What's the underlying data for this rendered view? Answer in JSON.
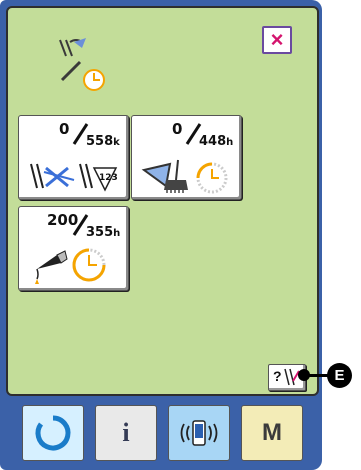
{
  "header": {
    "icon": "needle-thread-timer-icon"
  },
  "close_button": {
    "label": "×",
    "icon": "close-icon"
  },
  "counters": [
    {
      "numerator": "0",
      "denominator": "558",
      "unit": "k",
      "icon": "needle-thread-counter-icon"
    },
    {
      "numerator": "0",
      "denominator": "448",
      "unit": "h",
      "icon": "cleaning-brush-timer-icon"
    },
    {
      "numerator": "200",
      "denominator": "355",
      "unit": "h",
      "icon": "oil-timer-icon"
    }
  ],
  "help_button": {
    "label": "?",
    "icon": "needle-help-icon"
  },
  "callout": {
    "letter": "E"
  },
  "bottom_bar": {
    "ready_key": {
      "icon": "ready-circle-icon"
    },
    "info_key": {
      "label": "i",
      "icon": "information-icon"
    },
    "comm_key": {
      "icon": "communication-icon"
    },
    "mode_key": {
      "label": "M",
      "icon": "mode-icon"
    }
  },
  "colors": {
    "screen_bg": "#c3dd99",
    "frame": "#3b61a8",
    "close_x": "#d4146e",
    "timer_orange": "#f5a400",
    "needle_blue": "#3a6fd8"
  }
}
